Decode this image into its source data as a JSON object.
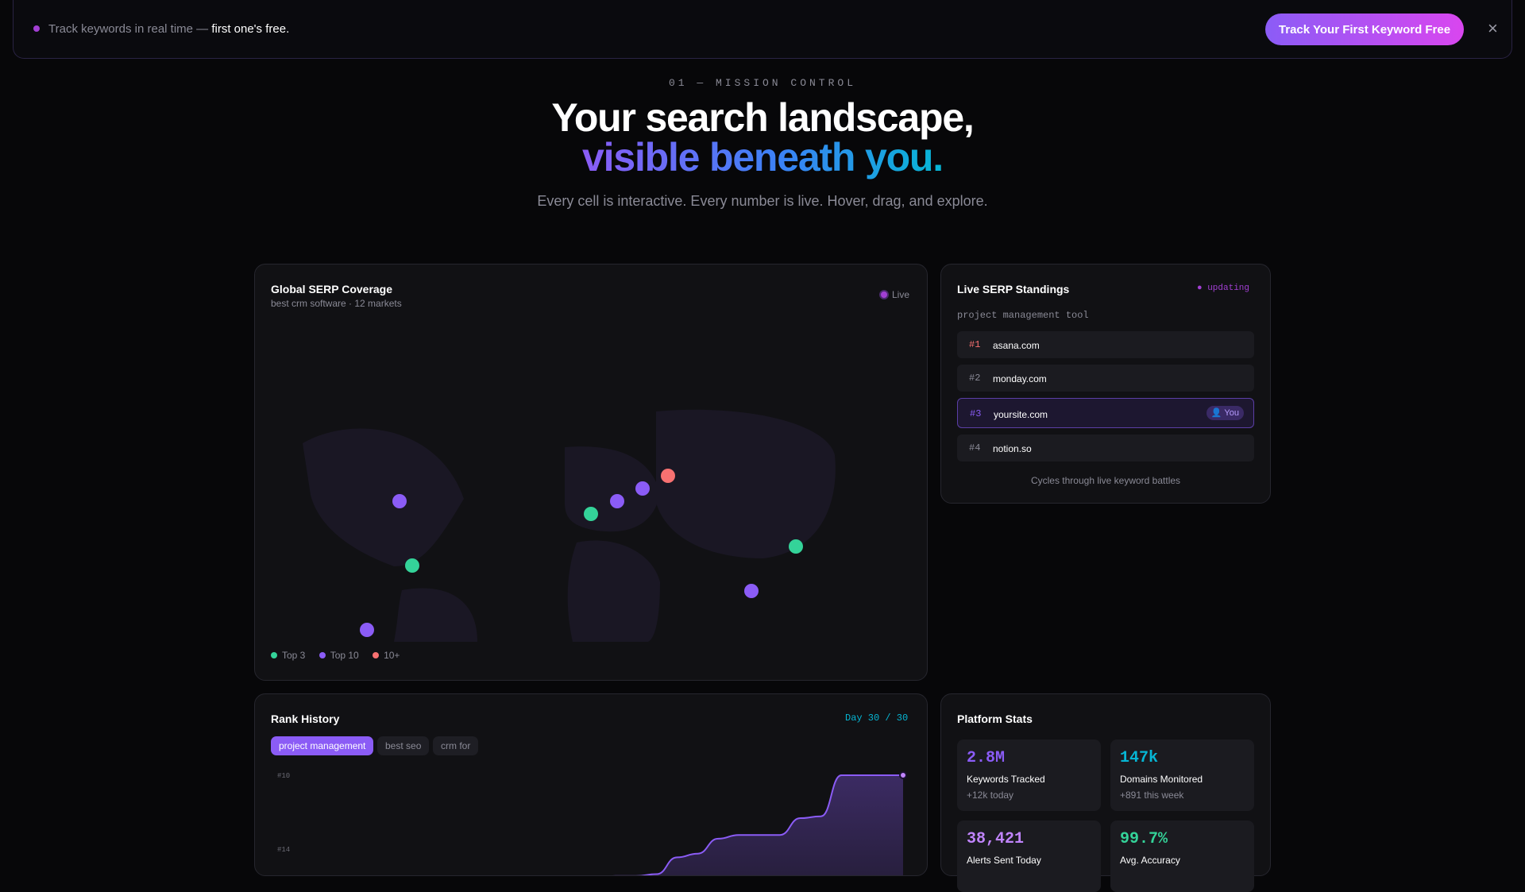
{
  "banner": {
    "text_prefix": "Track keywords in real time — ",
    "text_highlight": "first one's free.",
    "cta_label": "Track Your First Keyword Free",
    "close_label": "×"
  },
  "hero": {
    "eyebrow": "01 — MISSION CONTROL",
    "title_line1": "Your search landscape,",
    "title_line2": "visible beneath you.",
    "subtitle": "Every cell is interactive. Every number is live. Hover, drag, and explore."
  },
  "coverage": {
    "title": "Global SERP Coverage",
    "subtitle": "best crm software · 12 markets",
    "live_label": "Live",
    "legend": [
      {
        "label": "Top 3",
        "color": "#34d399"
      },
      {
        "label": "Top 10",
        "color": "#8b5cf6"
      },
      {
        "label": "10+",
        "color": "#f87171"
      }
    ],
    "markers": [
      {
        "tier": "Top 10"
      },
      {
        "tier": "Top 3"
      },
      {
        "tier": "Top 10"
      },
      {
        "tier": "Top 3"
      },
      {
        "tier": "Top 10"
      },
      {
        "tier": "Top 10"
      },
      {
        "tier": "10+"
      },
      {
        "tier": "Top 3"
      },
      {
        "tier": "Top 10"
      }
    ]
  },
  "standings": {
    "title": "Live SERP Standings",
    "status": "● updating",
    "query": "project management tool",
    "rows": [
      {
        "rank": "#1",
        "domain": "asana.com",
        "rank_color": "#f87171"
      },
      {
        "rank": "#2",
        "domain": "monday.com",
        "rank_color": "#8a8a96"
      },
      {
        "rank": "#3",
        "domain": "yoursite.com",
        "rank_color": "#8b5cf6",
        "badge": "👤 You"
      },
      {
        "rank": "#4",
        "domain": "notion.so",
        "rank_color": "#8a8a96"
      }
    ],
    "footer": "Cycles through live keyword battles"
  },
  "rank_history": {
    "title": "Rank History",
    "day_counter": "Day 30 / 30",
    "chips": [
      {
        "label": "project management",
        "active": true
      },
      {
        "label": "best seo",
        "active": false
      },
      {
        "label": "crm for",
        "active": false
      }
    ],
    "y_ticks": [
      "#10",
      "#14"
    ]
  },
  "chart_data": {
    "type": "area",
    "title": "Rank History",
    "series": [
      {
        "name": "project management",
        "values": [
          null,
          null,
          null,
          null,
          null,
          null,
          null,
          null,
          null,
          null,
          null,
          null,
          17.5,
          17.3,
          16.5,
          15.5,
          15.4,
          15.4,
          15.3,
          14.4,
          14.2,
          13.4,
          13.2,
          13.2,
          13.2,
          12.3,
          12.2,
          10,
          10,
          10,
          10
        ]
      }
    ],
    "x": [
      0,
      1,
      2,
      3,
      4,
      5,
      6,
      7,
      8,
      9,
      10,
      11,
      12,
      13,
      14,
      15,
      16,
      17,
      18,
      19,
      20,
      21,
      22,
      23,
      24,
      25,
      26,
      27,
      28,
      29,
      30
    ],
    "y_ticks": [
      "#10",
      "#14"
    ],
    "y_axis": "rank (inverted, #10 at top)",
    "color": "#8b5cf6"
  },
  "stats": {
    "title": "Platform Stats",
    "items": [
      {
        "value": "2.8M",
        "label": "Keywords Tracked",
        "delta": "+12k today",
        "color": "#8b5cf6"
      },
      {
        "value": "147k",
        "label": "Domains Monitored",
        "delta": "+891 this week",
        "color": "#06b6d4"
      },
      {
        "value": "38,421",
        "label": "Alerts Sent Today",
        "delta": "",
        "color": "#c084fc"
      },
      {
        "value": "99.7%",
        "label": "Avg. Accuracy",
        "delta": "",
        "color": "#34d399"
      }
    ]
  }
}
